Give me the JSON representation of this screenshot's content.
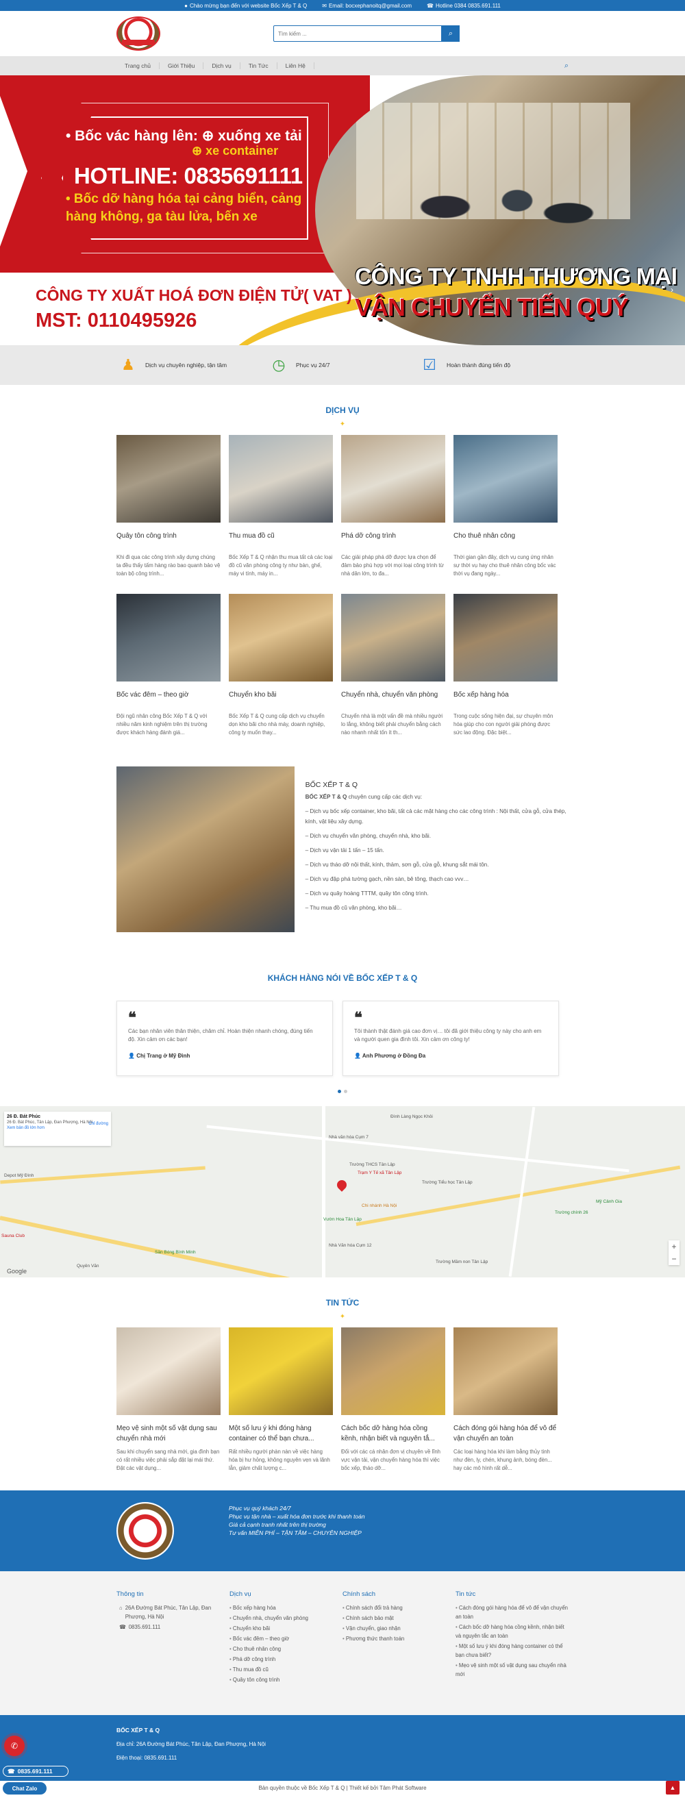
{
  "topbar": {
    "welcome": "Chào mừng bạn đến với website Bốc Xếp T & Q",
    "email": "Email: bocxephanoitq@gmail.com",
    "hotline": "Hotline 0384 0835.691.111"
  },
  "header": {
    "search_placeholder": "Tìm kiếm ...",
    "search_icon": "search-icon"
  },
  "nav": {
    "items": [
      "Trang chủ",
      "Giới Thiệu",
      "Dịch vụ",
      "Tin Tức",
      "Liên Hệ"
    ]
  },
  "banner": {
    "line1": "• Bốc vác hàng lên: ⊕ xuống xe tải",
    "line2": "⊕ xe container",
    "hotline": "HOTLINE: 0835691111",
    "line3": "• Bốc dỡ hàng hóa tại cảng biển, cảng hàng không, ga tàu lửa, bến xe",
    "company1": "CÔNG TY TNHH THƯƠNG MẠI",
    "company2": "VẬN CHUYỂN TIẾN QUÝ",
    "vat": "CÔNG TY XUẤT HOÁ ĐƠN ĐIỆN TỬ( VAT )",
    "mst": "MST: 0110495926",
    "prev": "‹",
    "next": "›"
  },
  "features": [
    {
      "icon": "worker-icon",
      "label": "Dịch vụ chuyên nghiệp, tận tâm"
    },
    {
      "icon": "clock-24-icon",
      "label": "Phục vụ 24/7"
    },
    {
      "icon": "checklist-icon",
      "label": "Hoàn thành đúng tiến độ"
    }
  ],
  "services": {
    "title": "DỊCH VỤ",
    "items": [
      {
        "title": "Quây tôn công trình",
        "desc": "Khi đi qua các công trình xây dựng chúng ta đều thấy tấm hàng rào bao quanh bảo vệ toàn bộ công trình..."
      },
      {
        "title": "Thu mua đồ cũ",
        "desc": "Bốc Xếp T & Q nhận thu mua tất cả các loại đồ cũ văn phòng công ty như bàn, ghế, máy vi tính, máy in..."
      },
      {
        "title": "Phá dỡ công trình",
        "desc": "Các giải pháp phá dỡ được lựa chọn để đảm bảo phù hợp với mọi loại công trình từ nhà dân lớn, to đa..."
      },
      {
        "title": "Cho thuê nhân công",
        "desc": "Thời gian gần đây, dịch vụ cung ứng nhân sự thời vụ hay cho thuê nhân công bốc vác thời vụ đang ngày..."
      },
      {
        "title": "Bốc vác đêm – theo giờ",
        "desc": "Đội ngũ nhân công Bốc Xếp T & Q với nhiều năm kinh nghiệm trên thị trường được khách hàng đánh giá..."
      },
      {
        "title": "Chuyển kho bãi",
        "desc": "Bốc Xếp T & Q cung cấp dịch vụ chuyển dọn kho bãi cho nhà máy, doanh nghiệp, công ty muốn thay..."
      },
      {
        "title": "Chuyển nhà, chuyển văn phòng",
        "desc": "Chuyển nhà là một vấn đề mà nhiều người lo lắng, không biết phải chuyển bằng cách nào nhanh nhất tốn ít th..."
      },
      {
        "title": "Bốc xếp hàng hóa",
        "desc": "Trong cuộc sống hiện đại, sự chuyên môn hóa giúp cho con người giải phóng được sức lao động. Đặc biệt..."
      }
    ]
  },
  "about": {
    "heading": "BỐC XẾP T & Q",
    "intro_bold": "BỐC XẾP T & Q",
    "intro": " chuyên cung cấp các dịch vụ:",
    "bullets": [
      "– Dịch vụ bốc xếp container, kho bãi, tất cả các mặt hàng cho các công trình : Nội thất, cửa gỗ, cửa thép, kính, vật liệu xây dựng.",
      "– Dịch vụ chuyển văn phòng, chuyển nhà, kho bãi.",
      "– Dịch vụ vận tải 1 tấn – 15 tấn.",
      "– Dịch vụ tháo dỡ nội thất, kính, thảm, sơn gỗ, cửa gỗ, khung sắt mái tôn.",
      "– Dịch vụ đập phá tường gạch, nền sàn, bê tông, thạch cao vvv…",
      "– Dịch vụ quây hoàng TTTM, quây tôn công trình.",
      "– Thu mua đồ cũ văn phòng, kho bãi…"
    ]
  },
  "testimonials": {
    "title": "KHÁCH HÀNG NÓI VỀ BỐC XẾP T & Q",
    "items": [
      {
        "text": "Các bạn nhân viên thân thiện, chăm chỉ. Hoàn thiện nhanh chóng, đúng tiến độ. Xin cảm ơn các bạn!",
        "author": "Chị Trang ở Mỹ Đình"
      },
      {
        "text": "Tôi thành thật đánh giá cao đơn vị… tôi đã giới thiệu công ty này cho anh em và người quen gia đình tôi. Xin cảm ơn công ty!",
        "author": "Anh Phương ở Đồng Đa"
      }
    ]
  },
  "map": {
    "place_title": "26 Đ. Bát Phúc",
    "place_address": "26 Đ. Bát Phúc, Tân Lập, Đan Phượng, Hà Nội",
    "directions": "Chỉ đường",
    "larger_map": "Xem bản đồ lớn hơn",
    "labels": [
      "Đình Làng Ngọc Khôi",
      "Nhà văn hóa Cụm 7",
      "Trường THCS Tân Lập",
      "Trạm Y Tế xã Tân Lập",
      "Chi nhánh Hà Nội",
      "Vườn Hoa Tân Lập",
      "Nhà Văn hóa Cụm 12",
      "Trường Tiểu học Tân Lập",
      "Trường Mầm non Tân Lập",
      "Sân Bóng Bình Minh",
      "Quyên Văn",
      "Depot Mỹ Đình",
      "Sauna Club",
      "Mỹ Cảnh Gia",
      "Trường chính 26",
      "Google"
    ],
    "zoom_in": "+",
    "zoom_out": "−"
  },
  "news": {
    "title": "TIN TỨC",
    "items": [
      {
        "title": "Mẹo vệ sinh một số vật dụng sau chuyển nhà mới",
        "desc": "Sau khi chuyển sang nhà mới, gia đình bạn có rất nhiều việc phải sắp đặt lại mái thứ. Đặt các vật dụng..."
      },
      {
        "title": "Một số lưu ý khi đóng hàng container có thể bạn chưa...",
        "desc": "Rất nhiều người phàn nàn về việc hàng hóa bị hư hỏng, không nguyên vẹn và lãnh lẫn, giảm chất lượng c..."
      },
      {
        "title": "Cách bốc dỡ hàng hóa cồng kềnh, nhận biết và nguyên tắ...",
        "desc": "Đối với các cá nhân đơn vị chuyên về lĩnh vực vận tải, vận chuyển hàng hóa thì việc bốc xếp, tháo dỡ..."
      },
      {
        "title": "Cách đóng gói hàng hóa để vô để vận chuyển an toàn",
        "desc": "Các loại hàng hóa khi làm bằng thủy tinh như đèn, ly, chén, khung ảnh, bóng đèn... hay các mô hình rất dễ..."
      }
    ]
  },
  "band": {
    "items": [
      "Phục vụ quý khách 24/7",
      "Phục vụ tận nhà – xuất hóa đơn trước khi thanh toán",
      "Giá cả cạnh tranh nhất trên thị trường",
      "Tư vấn MIỄN PHÍ – TẬN TÂM – CHUYÊN NGHIỆP"
    ]
  },
  "footer": {
    "info_title": "Thông tin",
    "info_address": "26A Đường Bát Phúc, Tân Lập, Đan Phượng, Hà Nội",
    "info_phone": "0835.691.111",
    "services_title": "Dịch vụ",
    "services": [
      "Bốc xếp hàng hóa",
      "Chuyển nhà, chuyển văn phòng",
      "Chuyển kho bãi",
      "Bốc vác đêm – theo giờ",
      "Cho thuê nhân công",
      "Phá dỡ công trình",
      "Thu mua đồ cũ",
      "Quây tôn công trình"
    ],
    "policy_title": "Chính sách",
    "policy": [
      "Chính sách đổi trả hàng",
      "Chính sách bảo mật",
      "Vận chuyển, giao nhận",
      "Phương thức thanh toán"
    ],
    "news_title": "Tin tức",
    "news": [
      "Cách đóng gói hàng hóa để vô để vận chuyển an toàn",
      "Cách bốc dỡ hàng hóa cồng kềnh, nhận biết và nguyên tắc an toàn",
      "Một số lưu ý khi đóng hàng container có thể bạn chưa biết?",
      "Mẹo vệ sinh một số vật dụng sau chuyển nhà mới"
    ]
  },
  "bottom": {
    "name": "BỐC XẾP T & Q",
    "address": "Địa chỉ: 26A Đường Bát Phúc, Tân Lập, Đan Phượng, Hà Nội",
    "phone": "Điện thoại: 0835.691.111",
    "copyright": "Bản quyền thuộc về Bốc Xếp T & Q | Thiết kế bởi Tâm Phát Software",
    "phone_pill": "0835.691.111",
    "zalo": "Chat Zalo",
    "to_top": "▲"
  },
  "colors": {
    "primary": "#1f6fb5",
    "banner_red": "#c8161d",
    "accent_yellow": "#f2c22a"
  }
}
